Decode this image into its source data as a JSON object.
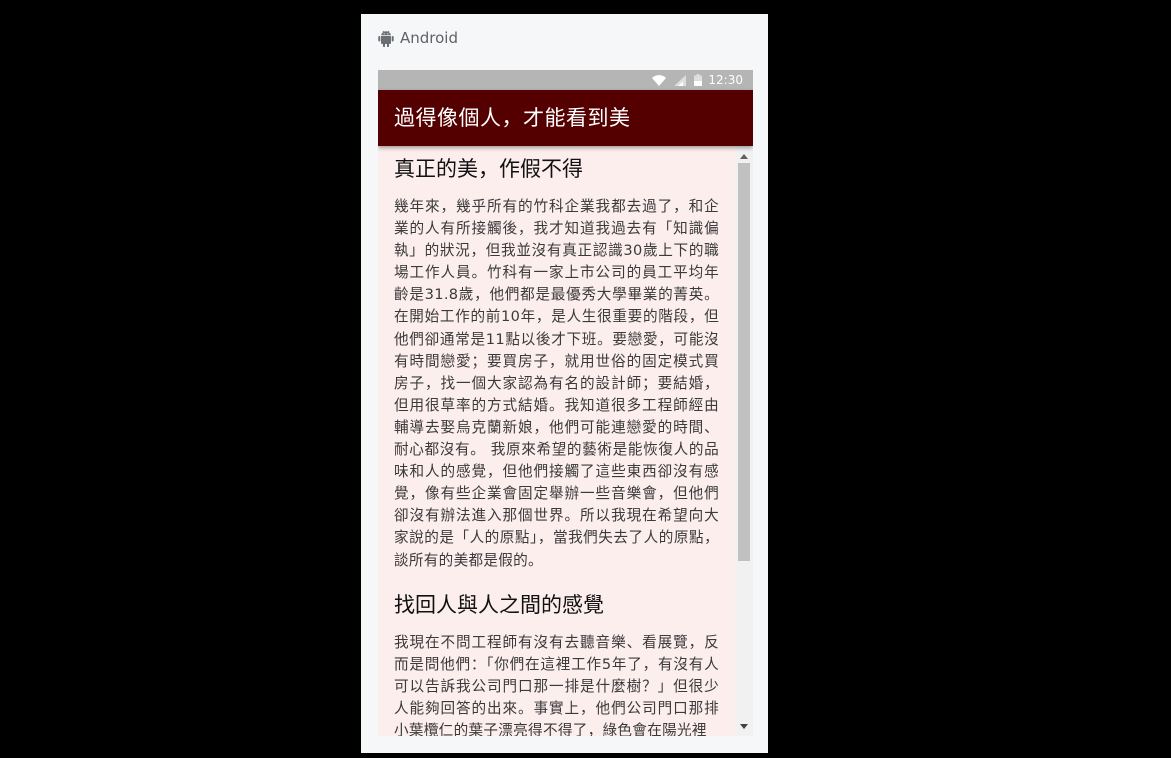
{
  "platform": {
    "label": "Android",
    "icon": "android-icon"
  },
  "statusbar": {
    "time": "12:30",
    "icons": [
      "wifi-icon",
      "signal-icon",
      "battery-icon"
    ]
  },
  "appbar": {
    "title": "過得像個人，才能看到美",
    "color": "#550000"
  },
  "article": {
    "sections": [
      {
        "heading": "真正的美，作假不得",
        "body": "幾年來，幾乎所有的竹科企業我都去過了，和企業的人有所接觸後，我才知道我過去有「知識偏執」的狀況，但我並沒有真正認識30歲上下的職場工作人員。竹科有一家上市公司的員工平均年齡是31.8歲，他們都是最優秀大學畢業的菁英。在開始工作的前10年，是人生很重要的階段，但他們卻通常是11點以後才下班。要戀愛，可能沒有時間戀愛；要買房子，就用世俗的固定模式買房子，找一個大家認為有名的設計師；要結婚，但用很草率的方式結婚。我知道很多工程師經由輔導去娶烏克蘭新娘，他們可能連戀愛的時間、耐心都沒有。 我原來希望的藝術是能恢復人的品味和人的感覺，但他們接觸了這些東西卻沒有感覺，像有些企業會固定舉辦一些音樂會，但他們卻沒有辦法進入那個世界。所以我現在希望向大家說的是「人的原點」，當我們失去了人的原點，談所有的美都是假的。"
      },
      {
        "heading": "找回人與人之間的感覺",
        "body": "我現在不問工程師有沒有去聽音樂、看展覽，反而是問他們：「你們在這裡工作5年了，有沒有人可以告訴我公司門口那一排是什麼樹？」但很少人能夠回答的出來。事實上，他們公司門口那排小葉欖仁的葉子漂亮得不得了，綠色會在陽光裡"
      }
    ],
    "background": "#fdeeee"
  }
}
